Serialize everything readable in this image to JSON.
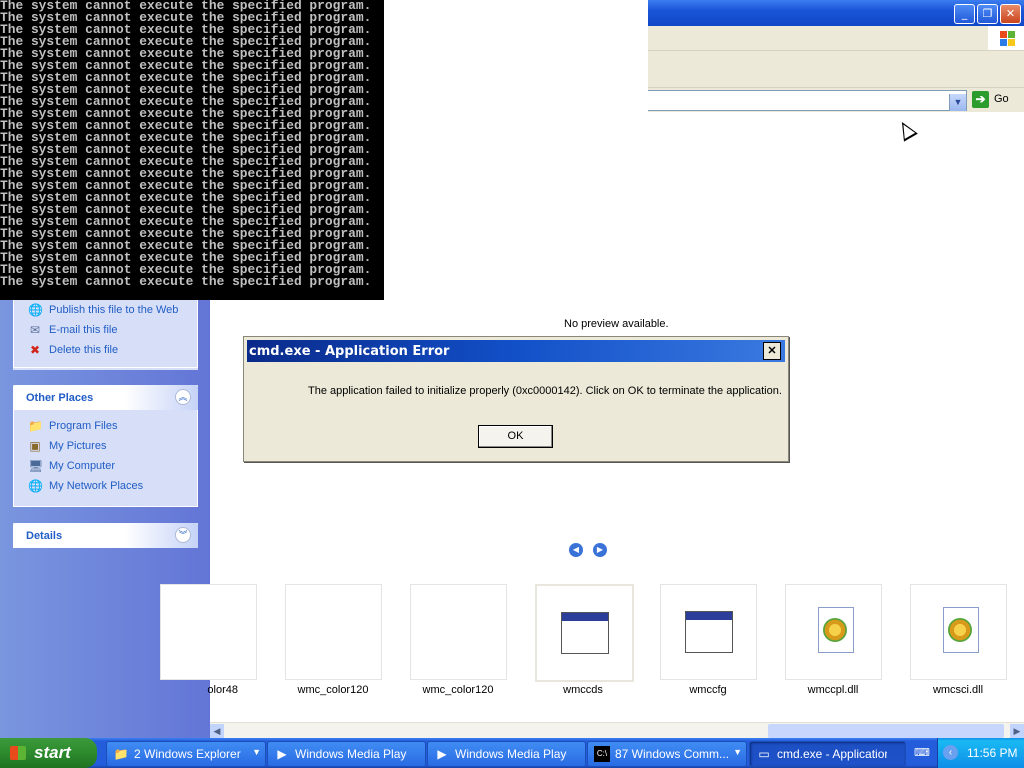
{
  "console": {
    "lines": [
      "The system cannot execute the specified program.",
      "The system cannot execute the specified program.",
      "The system cannot execute the specified program.",
      "The system cannot execute the specified program.",
      "The system cannot execute the specified program.",
      "The system cannot execute the specified program.",
      "The system cannot execute the specified program.",
      "The system cannot execute the specified program.",
      "The system cannot execute the specified program.",
      "The system cannot execute the specified program.",
      "The system cannot execute the specified program.",
      "The system cannot execute the specified program.",
      "The system cannot execute the specified program.",
      "The system cannot execute the specified program.",
      "The system cannot execute the specified program.",
      "The system cannot execute the specified program.",
      "The system cannot execute the specified program.",
      "The system cannot execute the specified program.",
      "The system cannot execute the specified program.",
      "The system cannot execute the specified program.",
      "The system cannot execute the specified program.",
      "The system cannot execute the specified program.",
      "The system cannot execute the specified program.",
      "The system cannot execute the specified program."
    ]
  },
  "explorer": {
    "go_label": "Go",
    "file_tasks": [
      {
        "label": "Publish this file to the Web",
        "icon": "globe-icon"
      },
      {
        "label": "E-mail this file",
        "icon": "email-icon"
      },
      {
        "label": "Delete this file",
        "icon": "delete-icon"
      }
    ],
    "other_places": {
      "title": "Other Places",
      "items": [
        {
          "label": "Program Files",
          "icon": "folder-icon"
        },
        {
          "label": "My Pictures",
          "icon": "pictures-icon"
        },
        {
          "label": "My Computer",
          "icon": "computer-icon"
        },
        {
          "label": "My Network Places",
          "icon": "network-icon"
        }
      ]
    },
    "details": {
      "title": "Details"
    },
    "preview_text": "No preview available.",
    "filmstrip": [
      {
        "label": "olor48",
        "type": "blank"
      },
      {
        "label": "wmc_color120",
        "type": "blank"
      },
      {
        "label": "wmc_color120",
        "type": "blank"
      },
      {
        "label": "wmccds",
        "type": "app",
        "selected": true
      },
      {
        "label": "wmccfg",
        "type": "app"
      },
      {
        "label": "wmccpl.dll",
        "type": "dll"
      },
      {
        "label": "wmcsci.dll",
        "type": "dll"
      }
    ]
  },
  "dialog": {
    "title": "cmd.exe - Application Error",
    "message": "The application failed to initialize properly (0xc0000142). Click on OK to terminate the application.",
    "ok_label": "OK",
    "close_glyph": "✕"
  },
  "taskbar": {
    "start_label": "start",
    "tasks": [
      {
        "label": "2 Windows Explorer",
        "icon": "folder-icon",
        "has_dropdown": true
      },
      {
        "label": "Windows Media Player",
        "icon": "media-player-icon"
      },
      {
        "label": "Windows Media Player",
        "icon": "media-player-icon"
      },
      {
        "label": "87 Windows Comm...",
        "icon": "console-icon",
        "has_dropdown": true
      },
      {
        "label": "cmd.exe - Application...",
        "icon": "window-icon",
        "active": true
      }
    ],
    "clock": "11:56 PM"
  }
}
